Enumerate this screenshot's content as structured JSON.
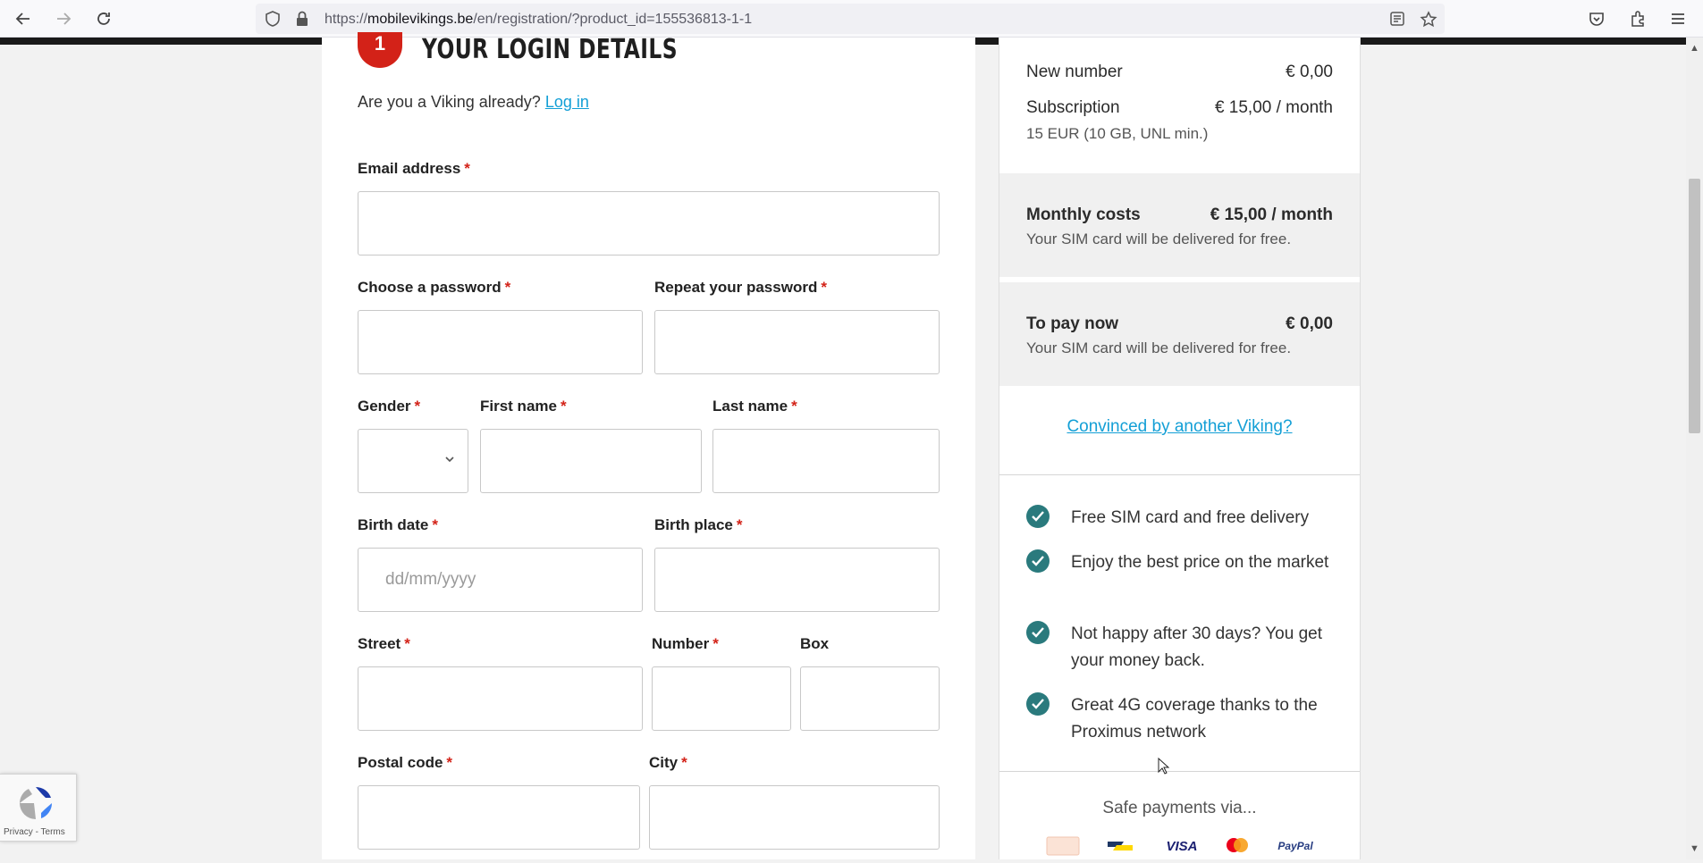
{
  "browser": {
    "url_prefix": "https://",
    "url_domain": "mobilevikings.be",
    "url_path": "/en/registration/?product_id=155536813-1-1"
  },
  "form": {
    "step_number": "1",
    "step_title": "YOUR LOGIN DETAILS",
    "login_prompt": "Are you a Viking already?",
    "login_link": "Log in",
    "required_mark": "*",
    "fields": {
      "email": "Email address",
      "password": "Choose a password",
      "repeat_password": "Repeat your password",
      "gender": "Gender",
      "first_name": "First name",
      "last_name": "Last name",
      "birth_date": "Birth date",
      "birth_date_placeholder": "dd/mm/yyyy",
      "birth_place": "Birth place",
      "street": "Street",
      "number": "Number",
      "box": "Box",
      "postal_code": "Postal code",
      "city": "City"
    }
  },
  "summary": {
    "new_number_label": "New number",
    "new_number_value": "€ 0,00",
    "subscription_label": "Subscription",
    "subscription_value": "€ 15,00 / month",
    "subscription_detail": "15 EUR (10 GB, UNL min.)",
    "monthly_label": "Monthly costs",
    "monthly_value": "€ 15,00 / month",
    "monthly_note": "Your SIM card will be delivered for free.",
    "pay_now_label": "To pay now",
    "pay_now_value": "€ 0,00",
    "pay_now_note": "Your SIM card will be delivered for free.",
    "convinced_link": "Convinced by another Viking?",
    "benefits": [
      "Free SIM card and free delivery",
      "Enjoy the best price on the market",
      "Not happy after 30 days? You get your money back.",
      "Great 4G coverage thanks to the Proximus network"
    ],
    "safe_payments": "Safe payments via...",
    "payment_methods": [
      "VISA",
      "PayPal"
    ]
  },
  "recaptcha": {
    "privacy": "Privacy",
    "separator": " - ",
    "terms": "Terms"
  },
  "colors": {
    "accent_red": "#d32218",
    "link_blue": "#139fd6",
    "check_teal": "#2a7a7d"
  }
}
